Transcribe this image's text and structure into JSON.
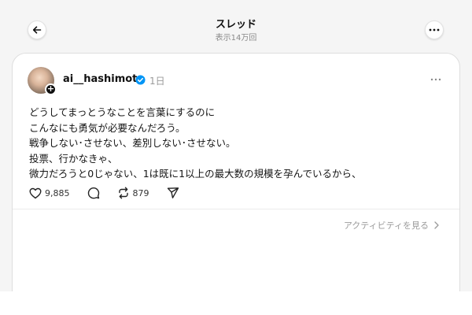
{
  "header": {
    "title": "スレッド",
    "views": "表示14万回",
    "back_icon": "arrow-left-icon",
    "more_icon": "more-horizontal-icon"
  },
  "post": {
    "username": "ai__hashimoto",
    "verified": true,
    "time": "1日",
    "lines": [
      "どうしてまっとうなことを言葉にするのに",
      "こんなにも勇気が必要なんだろう。",
      "戦争しない･させない、差別しない･させない。",
      "投票、行かなきゃ、",
      "微力だろうと0じゃない、1は既に1以上の最大数の規模を孕んでいるから、"
    ],
    "likes": "9,885",
    "reposts": "879",
    "accent": "#0095f6"
  },
  "footer": {
    "activity_label": "アクティビティを見る"
  }
}
